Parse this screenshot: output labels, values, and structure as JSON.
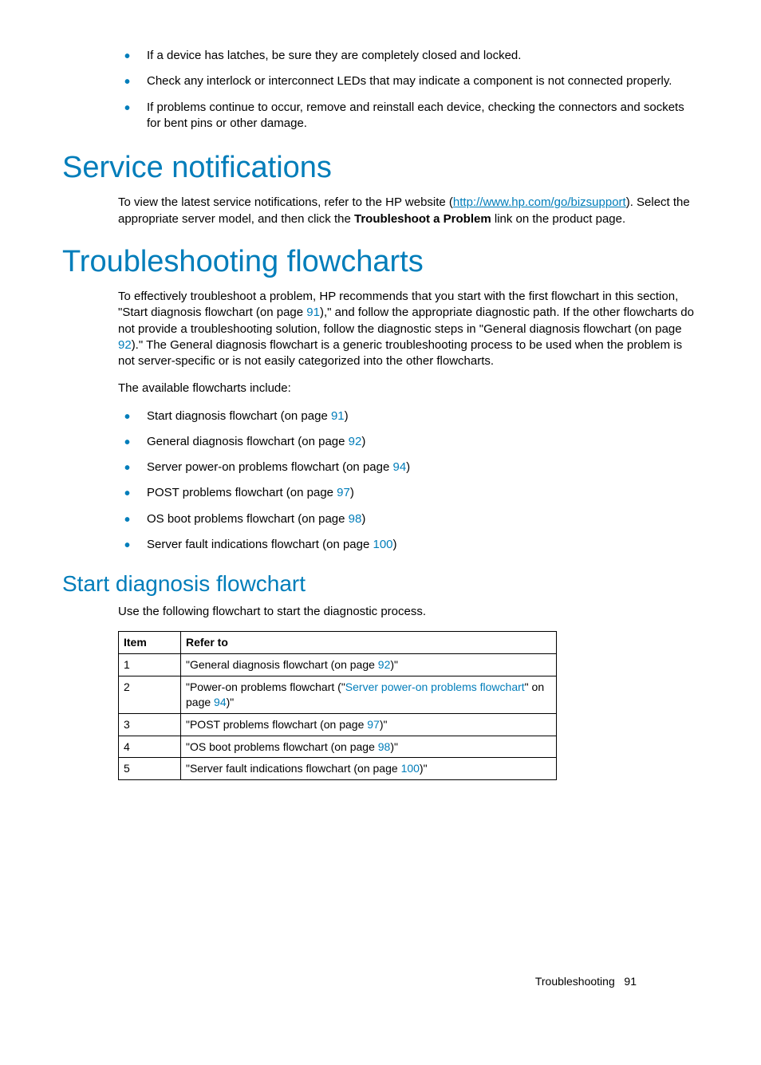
{
  "top_bullets": [
    "If a device has latches, be sure they are completely closed and locked.",
    "Check any interlock or interconnect LEDs that may indicate a component is not connected properly.",
    "If problems continue to occur, remove and reinstall each device, checking the connectors and sockets for bent pins or other damage."
  ],
  "service": {
    "heading": "Service notifications",
    "para_pre": "To view the latest service notifications, refer to the HP website (",
    "url": "http://www.hp.com/go/bizsupport",
    "para_post1": "). Select the appropriate server model, and then click the ",
    "bold": "Troubleshoot a Problem",
    "para_post2": " link on the product page."
  },
  "trouble": {
    "heading": "Troubleshooting flowcharts",
    "para1_a": "To effectively troubleshoot a problem, HP recommends that you start with the first flowchart in this section, \"Start diagnosis flowchart (on page ",
    "pg1": "91",
    "para1_b": "),\" and follow the appropriate diagnostic path. If the other flowcharts do not provide a troubleshooting solution, follow the diagnostic steps in \"General diagnosis flowchart (on page ",
    "pg2": "92",
    "para1_c": ").\" The General diagnosis flowchart is a generic troubleshooting process to be used when the problem is not server-specific or is not easily categorized into the other flowcharts.",
    "para2": "The available flowcharts include:",
    "list": [
      {
        "pre": "Start diagnosis flowchart (on page ",
        "pg": "91",
        "post": ")"
      },
      {
        "pre": "General diagnosis flowchart (on page ",
        "pg": "92",
        "post": ")"
      },
      {
        "pre": "Server power-on problems flowchart (on page ",
        "pg": "94",
        "post": ")"
      },
      {
        "pre": "POST problems flowchart (on page ",
        "pg": "97",
        "post": ")"
      },
      {
        "pre": "OS boot problems flowchart (on page ",
        "pg": "98",
        "post": ")"
      },
      {
        "pre": "Server fault indications flowchart (on page ",
        "pg": "100",
        "post": ")"
      }
    ]
  },
  "start": {
    "heading": "Start diagnosis flowchart",
    "para": "Use the following flowchart to start the diagnostic process.",
    "th1": "Item",
    "th2": "Refer to",
    "rows": [
      {
        "n": "1",
        "a": "\"General diagnosis flowchart (on page ",
        "pg": "92",
        "b": ")\""
      },
      {
        "n": "2",
        "a": "\"Power-on problems flowchart (\"",
        "link": "Server power-on problems flowchart",
        "mid": "\" on page ",
        "pg": "94",
        "b": ")\""
      },
      {
        "n": "3",
        "a": "\"POST problems flowchart (on page ",
        "pg": "97",
        "b": ")\""
      },
      {
        "n": "4",
        "a": "\"OS boot problems flowchart (on page ",
        "pg": "98",
        "b": ")\""
      },
      {
        "n": "5",
        "a": "\"Server fault indications flowchart (on page ",
        "pg": "100",
        "b": ")\""
      }
    ]
  },
  "footer": {
    "section": "Troubleshooting",
    "page": "91"
  }
}
